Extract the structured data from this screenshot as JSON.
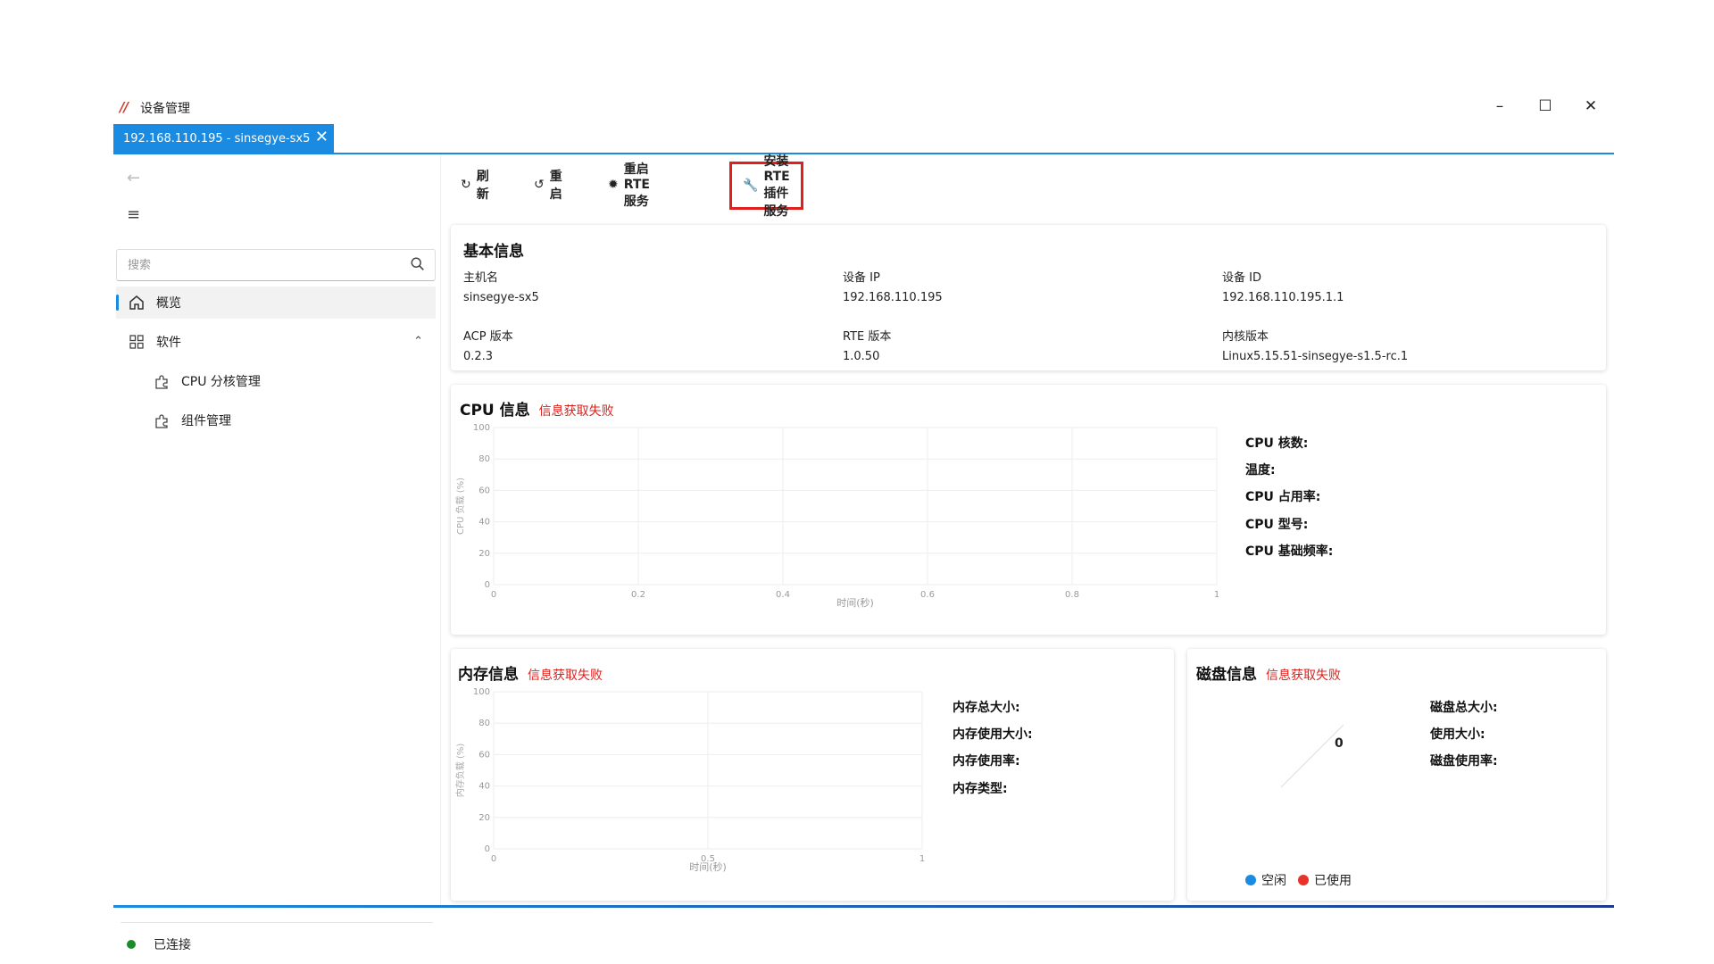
{
  "window": {
    "app_title": "设备管理",
    "logo_text": "ሎ"
  },
  "tab": {
    "label": "192.168.110.195 - sinsegye-sx5"
  },
  "sidebar": {
    "search_placeholder": "搜索",
    "items": [
      {
        "label": "概览"
      },
      {
        "label": "软件"
      }
    ],
    "sub_items": [
      {
        "label": "CPU 分核管理"
      },
      {
        "label": "组件管理"
      }
    ],
    "status": "已连接"
  },
  "toolbar": {
    "refresh": "刷新",
    "restart": "重启",
    "restart_rte": "重启 RTE 服务",
    "install_rte": "安装 RTE 插件服务"
  },
  "basic_info": {
    "title": "基本信息",
    "fields": [
      {
        "label": "主机名",
        "value": "sinsegye-sx5"
      },
      {
        "label": "设备 IP",
        "value": "192.168.110.195"
      },
      {
        "label": "设备 ID",
        "value": "192.168.110.195.1.1"
      },
      {
        "label": "ACP 版本",
        "value": "0.2.3"
      },
      {
        "label": "RTE 版本",
        "value": "1.0.50"
      },
      {
        "label": "内核版本",
        "value": "Linux5.15.51-sinsegye-s1.5-rc.1"
      }
    ]
  },
  "cpu": {
    "title": "CPU 信息",
    "error": "信息获取失败",
    "stats": [
      "CPU 核数:",
      "温度:",
      "CPU 占用率:",
      "CPU 型号:",
      "CPU 基础频率:"
    ]
  },
  "memory": {
    "title": "内存信息",
    "error": "信息获取失败",
    "stats": [
      "内存总大小:",
      "内存使用大小:",
      "内存使用率:",
      "内存类型:"
    ]
  },
  "disk": {
    "title": "磁盘信息",
    "error": "信息获取失败",
    "stats": [
      "磁盘总大小:",
      "使用大小:",
      "磁盘使用率:"
    ],
    "pie_center": "0",
    "legend": [
      {
        "label": "空闲",
        "color": "#1a8be0"
      },
      {
        "label": "已使用",
        "color": "#e8332a"
      }
    ]
  },
  "chart_data": [
    {
      "type": "line",
      "title": "CPU 信息",
      "xlabel": "时间(秒)",
      "ylabel": "CPU 负载 (%)",
      "x_ticks": [
        "0",
        "0.2",
        "0.4",
        "0.6",
        "0.8",
        "1"
      ],
      "y_ticks": [
        "0",
        "20",
        "40",
        "60",
        "80",
        "100"
      ],
      "xlim": [
        0,
        1
      ],
      "ylim": [
        0,
        100
      ],
      "series": [],
      "grid": true
    },
    {
      "type": "line",
      "title": "内存信息",
      "xlabel": "时间(秒)",
      "ylabel": "内存负载 (%)",
      "x_ticks": [
        "0",
        "0.5",
        "1"
      ],
      "y_ticks": [
        "0",
        "20",
        "40",
        "60",
        "80",
        "100"
      ],
      "xlim": [
        0,
        1
      ],
      "ylim": [
        0,
        100
      ],
      "series": [],
      "grid": true
    },
    {
      "type": "pie",
      "title": "磁盘信息",
      "categories": [
        "空闲",
        "已使用"
      ],
      "values": [
        0,
        0
      ]
    }
  ],
  "colors": {
    "accent": "#1a8be0",
    "error": "#e0201c",
    "connected": "#1c8c2b"
  }
}
